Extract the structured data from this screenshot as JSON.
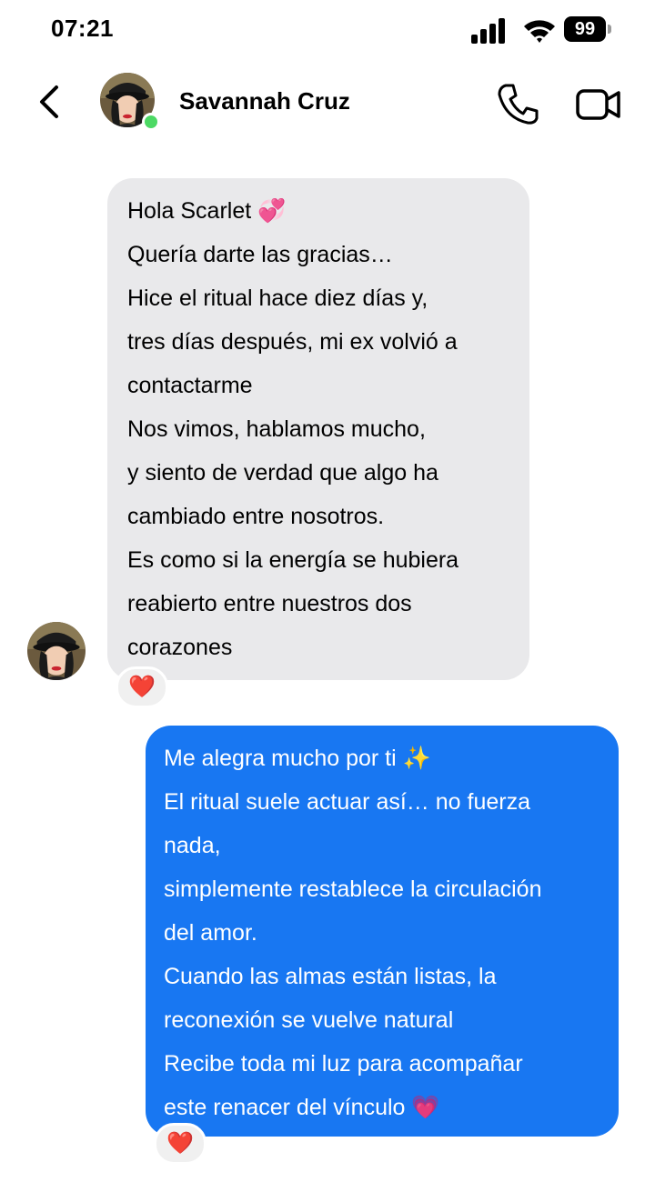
{
  "status_bar": {
    "time": "07:21",
    "battery": "99"
  },
  "header": {
    "contact_name": "Savannah Cruz",
    "online_color": "#4cd964",
    "icons": [
      "back-icon",
      "phone-icon",
      "video-camera-icon"
    ]
  },
  "messages": [
    {
      "direction": "incoming",
      "lines": [
        "Hola Scarlet 💞",
        "Quería darte las gracias…",
        "Hice el ritual hace diez días y,",
        "tres días después, mi ex volvió a",
        "contactarme",
        "Nos vimos, hablamos mucho,",
        "y siento de verdad que algo ha",
        "cambiado entre nosotros.",
        "Es como si la energía se hubiera",
        "reabierto entre nuestros dos",
        "corazones"
      ],
      "reaction": "❤️"
    },
    {
      "direction": "outgoing",
      "lines": [
        "Me alegra mucho por ti ✨",
        "El ritual suele actuar así… no fuerza",
        "nada,",
        "simplemente restablece la circulación",
        "del amor.",
        "Cuando las almas están listas, la",
        "reconexión se vuelve natural",
        "Recibe toda mi luz para acompañar",
        "este renacer del vínculo 💗"
      ],
      "reaction": "❤️"
    }
  ],
  "colors": {
    "incoming_bubble": "#e9e9eb",
    "outgoing_bubble": "#1877f2"
  }
}
